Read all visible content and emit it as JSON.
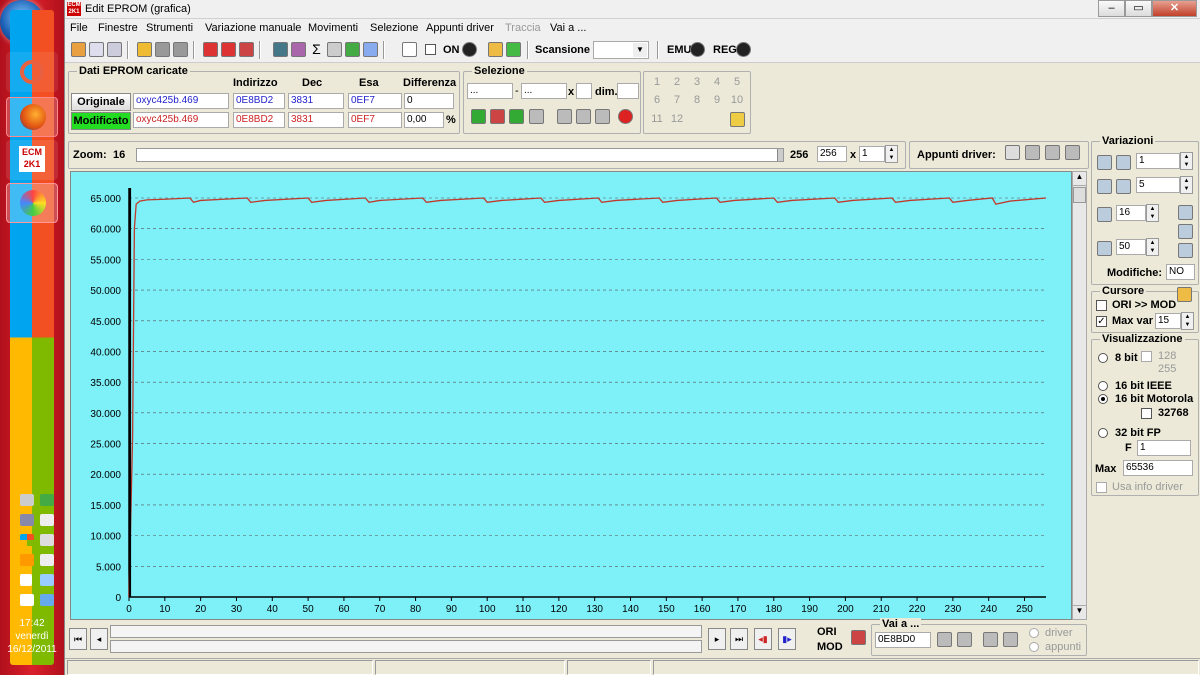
{
  "window": {
    "title": "Edit EPROM (grafica)"
  },
  "menu": [
    "File",
    "Finestre",
    "Strumenti",
    "Variazione manuale",
    "Movimenti",
    "Selezione",
    "Appunti driver",
    "Traccia",
    "Vai a ..."
  ],
  "toolbar": {
    "on_label": "ON",
    "scansione_label": "Scansione",
    "emu_label": "EMU",
    "reg_label": "REG"
  },
  "eprom": {
    "group_title": "Dati EPROM caricate",
    "col_indirizzo": "Indirizzo",
    "col_dec": "Dec",
    "col_esa": "Esa",
    "col_diff": "Differenza",
    "originale": {
      "label": "Originale",
      "file": "oxyc425b.469",
      "indirizzo": "0E8BD2",
      "dec": "3831",
      "esa": "0EF7",
      "diff": "0"
    },
    "modificato": {
      "label": "Modificato",
      "file": "oxyc425b.469",
      "indirizzo": "0E8BD2",
      "dec": "3831",
      "esa": "0EF7",
      "diff": "0,00",
      "pct": "%"
    }
  },
  "selezione": {
    "title": "Selezione",
    "from": "...",
    "to": "...",
    "x": "x",
    "dim": "dim."
  },
  "keypad": [
    "1",
    "2",
    "3",
    "4",
    "5",
    "6",
    "7",
    "8",
    "9",
    "10",
    "11",
    "12"
  ],
  "zoom": {
    "label": "Zoom:",
    "value": "16",
    "max": "256",
    "field": "256",
    "x": "x",
    "mult": "1",
    "appunti": "Appunti driver:"
  },
  "variazioni": {
    "title": "Variazioni",
    "v1": "1",
    "v2": "5",
    "v3": "16",
    "v4": "50",
    "modifiche_label": "Modifiche:",
    "modifiche": "NO"
  },
  "cursore": {
    "title": "Cursore",
    "ori_mod": "ORI >> MOD",
    "maxvar": "Max var",
    "maxvar_val": "15"
  },
  "visual": {
    "title": "Visualizzazione",
    "b8": "8 bit",
    "c128": "128",
    "c255": "255",
    "ieee": "16 bit IEEE",
    "moto": "16 bit Motorola",
    "c32768": "32768",
    "fp": "32 bit FP",
    "f_label": "F",
    "f_val": "1",
    "max_label": "Max",
    "max_val": "65536",
    "usa": "Usa info driver"
  },
  "bottom": {
    "ori": "ORI",
    "mod": "MOD",
    "vai_a": "Vai a ...",
    "vai_val": "0E8BD0",
    "driver": "driver",
    "appunti": "appunti"
  },
  "clock": {
    "time": "17:42",
    "day": "venerdì",
    "date": "16/12/2011"
  },
  "chart_data": {
    "type": "line",
    "title": "",
    "xlabel": "",
    "ylabel": "",
    "xlim": [
      0,
      256
    ],
    "ylim": [
      0,
      65000
    ],
    "grid": true,
    "yticks": [
      "0",
      "5.000",
      "10.000",
      "15.000",
      "20.000",
      "25.000",
      "30.000",
      "35.000",
      "40.000",
      "45.000",
      "50.000",
      "55.000",
      "60.000",
      "65.000"
    ],
    "xticks": [
      0,
      10,
      20,
      30,
      40,
      50,
      60,
      70,
      80,
      90,
      100,
      110,
      120,
      130,
      140,
      150,
      160,
      170,
      180,
      190,
      200,
      210,
      220,
      230,
      240,
      250
    ],
    "series": [
      {
        "color": "#c0392b",
        "x": [
          0,
          1,
          1.5,
          2,
          3,
          5,
          10,
          17,
          18,
          20,
          33,
          34,
          38,
          50,
          51,
          55,
          66,
          67,
          70,
          82,
          83,
          87,
          99,
          100,
          104,
          115,
          116,
          120,
          131,
          132,
          136,
          148,
          149,
          153,
          164,
          165,
          169,
          180,
          181,
          185,
          197,
          198,
          202,
          213,
          214,
          218,
          229,
          230,
          234,
          241,
          242,
          246,
          256
        ],
        "y": [
          0,
          26000,
          60000,
          64000,
          64500,
          64700,
          64800,
          65000,
          64300,
          64600,
          65000,
          64300,
          64600,
          65000,
          64300,
          64600,
          65000,
          64300,
          64600,
          65000,
          64300,
          64600,
          65000,
          64300,
          64600,
          65000,
          64300,
          64600,
          65000,
          64300,
          64600,
          65000,
          64300,
          64600,
          65000,
          64300,
          64600,
          65000,
          64300,
          64600,
          65000,
          64300,
          64600,
          65000,
          64300,
          64600,
          65000,
          64300,
          64600,
          65000,
          64000,
          64500,
          65000
        ]
      }
    ]
  }
}
